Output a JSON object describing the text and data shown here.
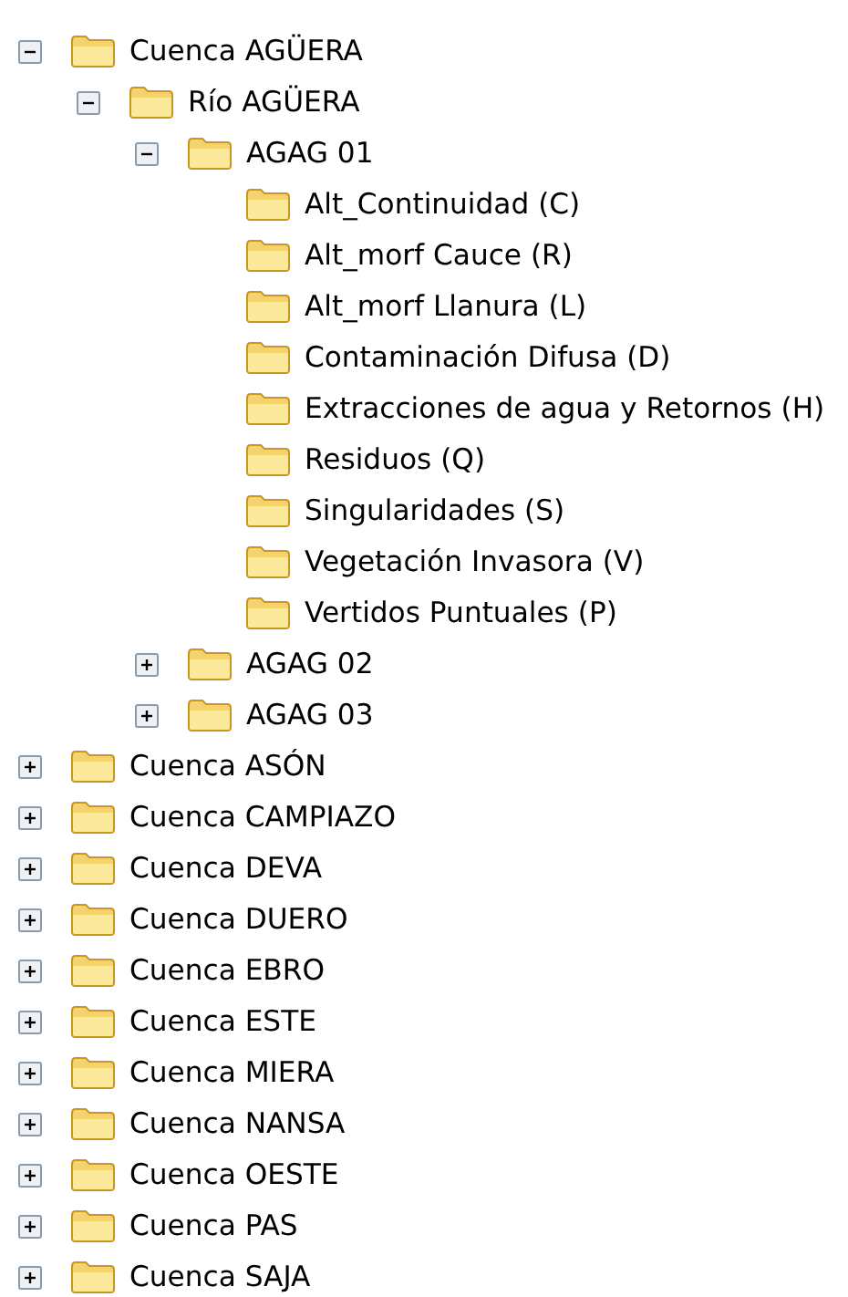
{
  "tree": [
    {
      "label": "Cuenca AGÜERA",
      "kind": "branch",
      "expanded": true,
      "children": [
        {
          "label": "Río AGÜERA",
          "kind": "branch",
          "expanded": true,
          "children": [
            {
              "label": "AGAG 01",
              "kind": "branch",
              "expanded": true,
              "children": [
                {
                  "label": "Alt_Continuidad (C)",
                  "kind": "leaf"
                },
                {
                  "label": "Alt_morf Cauce (R)",
                  "kind": "leaf"
                },
                {
                  "label": "Alt_morf Llanura (L)",
                  "kind": "leaf"
                },
                {
                  "label": "Contaminación Difusa (D)",
                  "kind": "leaf"
                },
                {
                  "label": "Extracciones de agua y Retornos (H)",
                  "kind": "leaf"
                },
                {
                  "label": "Residuos (Q)",
                  "kind": "leaf"
                },
                {
                  "label": "Singularidades (S)",
                  "kind": "leaf"
                },
                {
                  "label": "Vegetación Invasora (V)",
                  "kind": "leaf"
                },
                {
                  "label": "Vertidos Puntuales  (P)",
                  "kind": "leaf"
                }
              ]
            },
            {
              "label": "AGAG 02",
              "kind": "branch",
              "expanded": false
            },
            {
              "label": "AGAG 03",
              "kind": "branch",
              "expanded": false
            }
          ]
        }
      ]
    },
    {
      "label": "Cuenca ASÓN",
      "kind": "branch",
      "expanded": false
    },
    {
      "label": "Cuenca CAMPIAZO",
      "kind": "branch",
      "expanded": false
    },
    {
      "label": "Cuenca DEVA",
      "kind": "branch",
      "expanded": false
    },
    {
      "label": "Cuenca DUERO",
      "kind": "branch",
      "expanded": false
    },
    {
      "label": "Cuenca EBRO",
      "kind": "branch",
      "expanded": false
    },
    {
      "label": "Cuenca ESTE",
      "kind": "branch",
      "expanded": false
    },
    {
      "label": "Cuenca MIERA",
      "kind": "branch",
      "expanded": false
    },
    {
      "label": "Cuenca NANSA",
      "kind": "branch",
      "expanded": false
    },
    {
      "label": "Cuenca OESTE",
      "kind": "branch",
      "expanded": false
    },
    {
      "label": "Cuenca PAS",
      "kind": "branch",
      "expanded": false
    },
    {
      "label": "Cuenca SAJA",
      "kind": "branch",
      "expanded": false
    }
  ]
}
